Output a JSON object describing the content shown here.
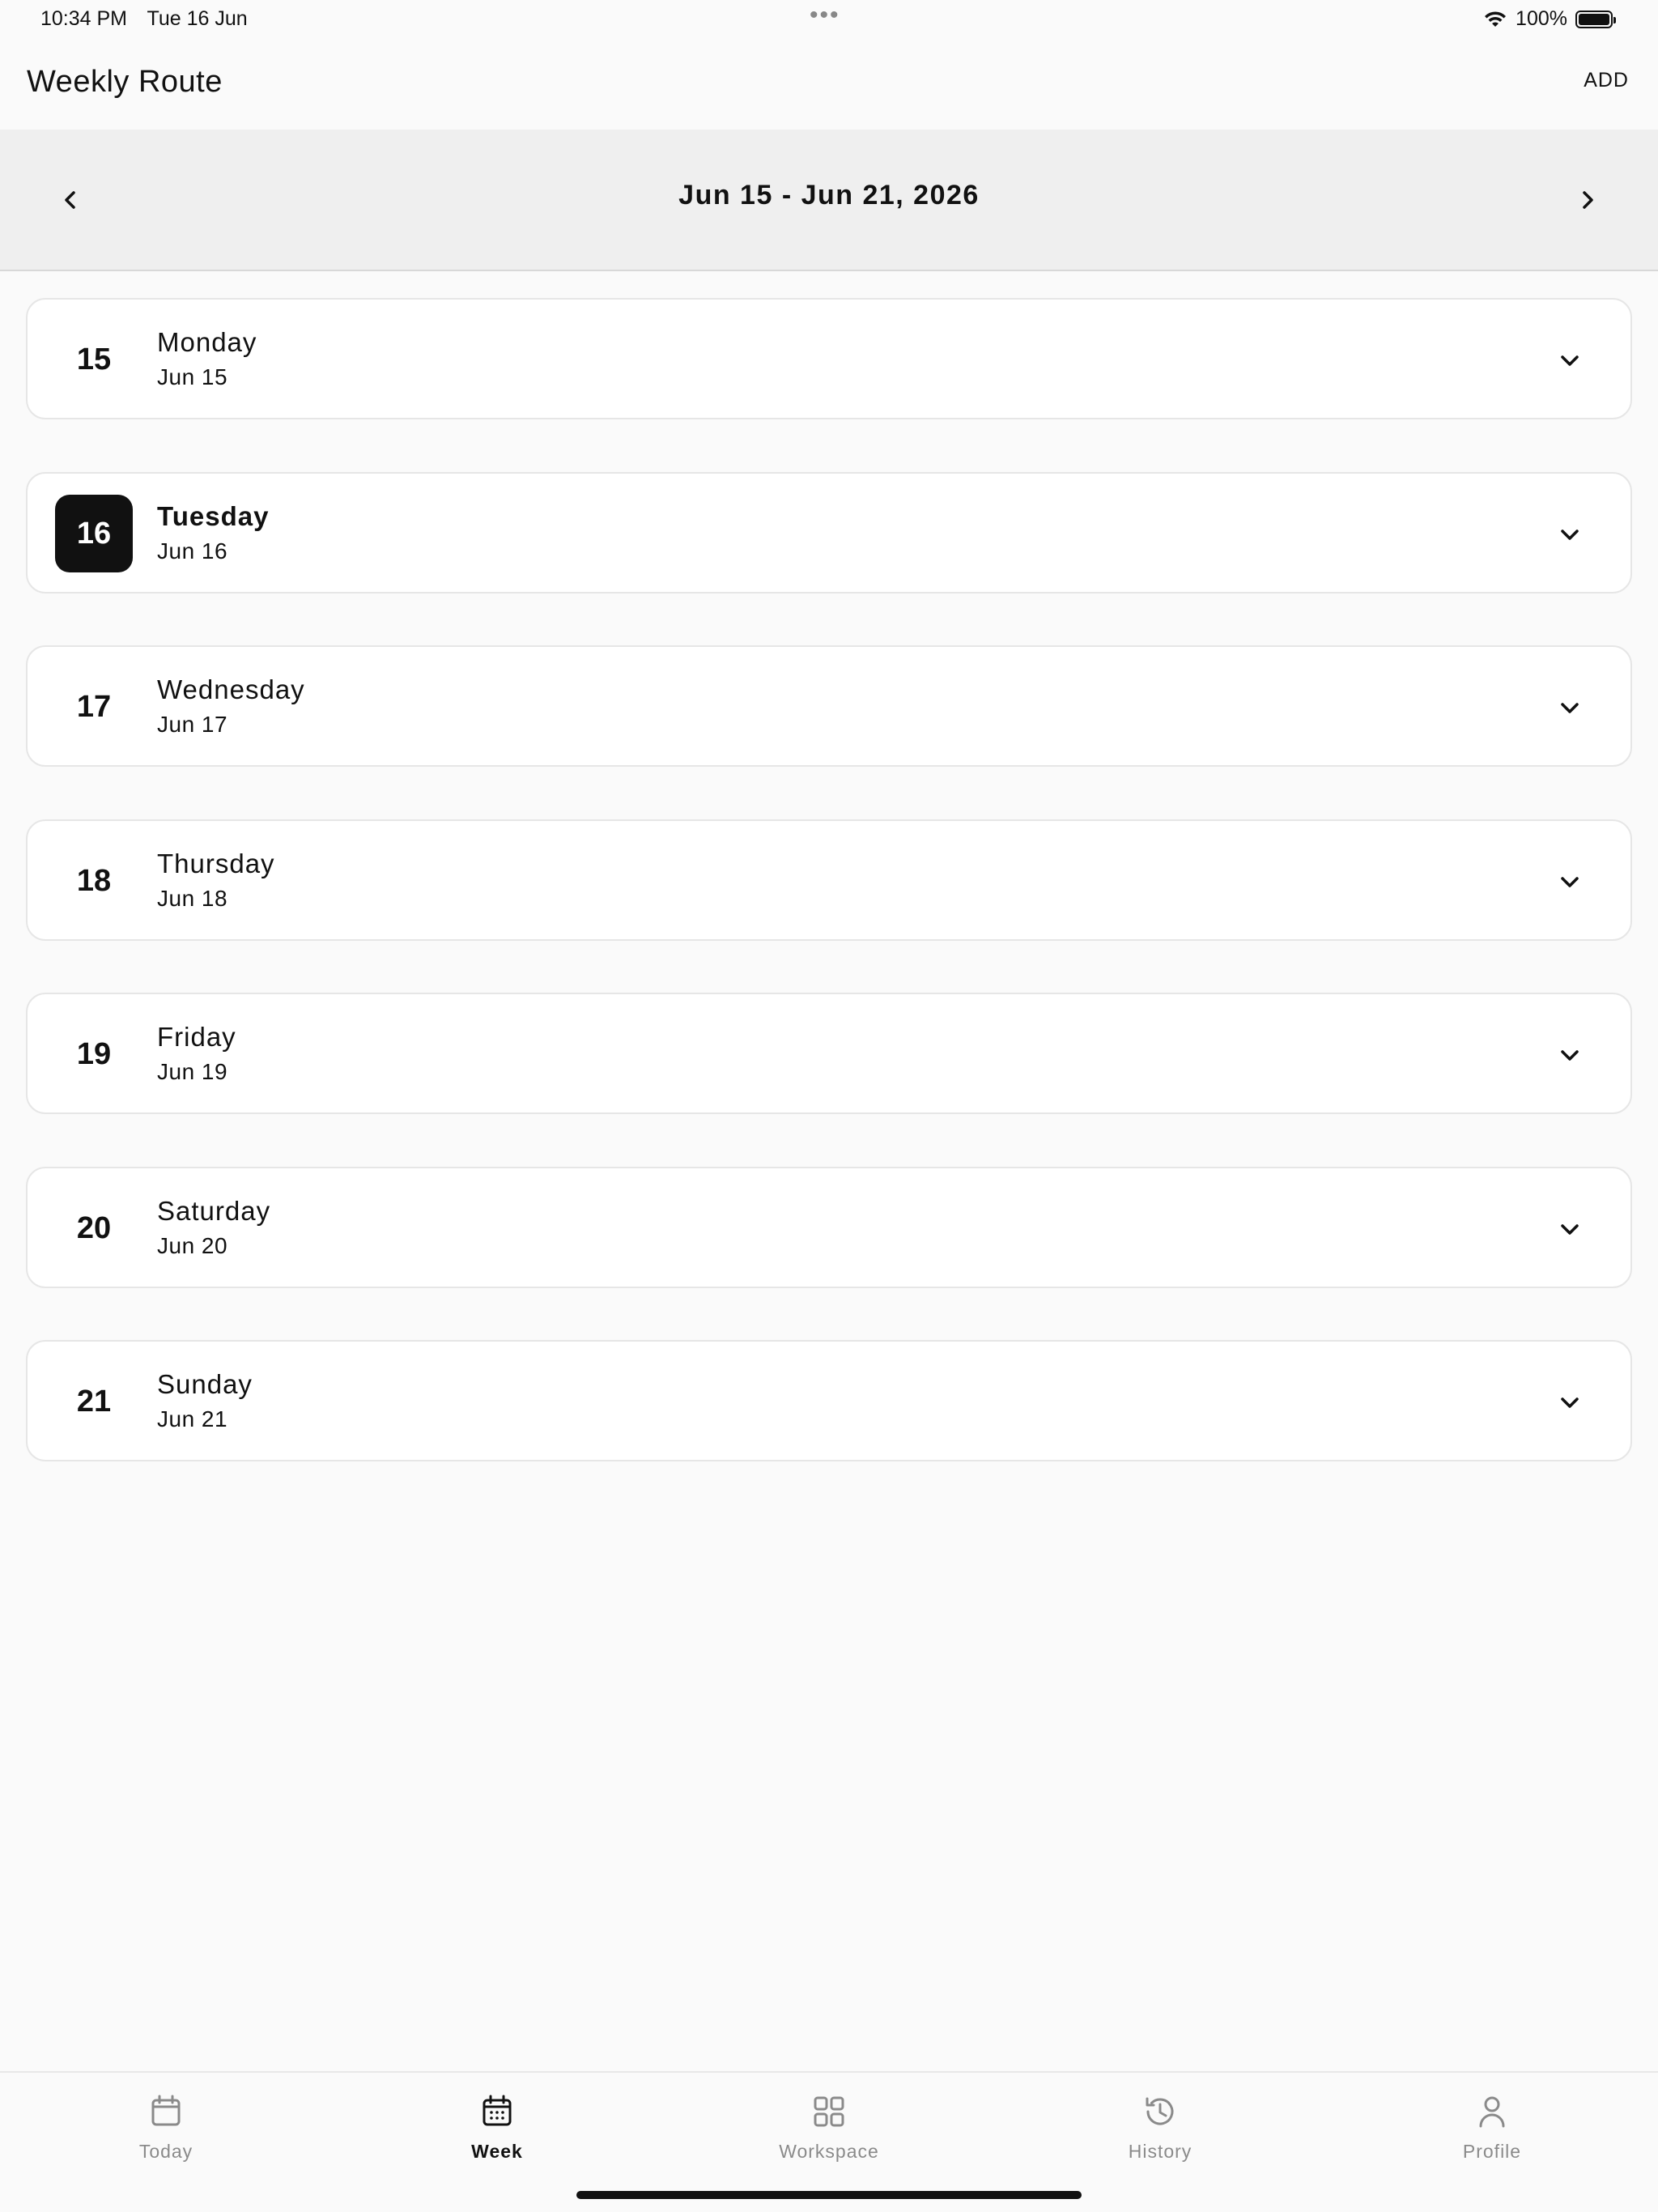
{
  "status_bar": {
    "time": "10:34 PM",
    "date": "Tue 16 Jun",
    "dots": "•••",
    "battery_percent": "100%"
  },
  "header": {
    "title": "Weekly Route",
    "add_label": "ADD"
  },
  "week_nav": {
    "range": "Jun 15 - Jun 21, 2026",
    "prev_icon": "chevron-left-icon",
    "next_icon": "chevron-right-icon"
  },
  "days": [
    {
      "num": "15",
      "name": "Monday",
      "date": "Jun 15",
      "selected": false
    },
    {
      "num": "16",
      "name": "Tuesday",
      "date": "Jun 16",
      "selected": true
    },
    {
      "num": "17",
      "name": "Wednesday",
      "date": "Jun 17",
      "selected": false
    },
    {
      "num": "18",
      "name": "Thursday",
      "date": "Jun 18",
      "selected": false
    },
    {
      "num": "19",
      "name": "Friday",
      "date": "Jun 19",
      "selected": false
    },
    {
      "num": "20",
      "name": "Saturday",
      "date": "Jun 20",
      "selected": false
    },
    {
      "num": "21",
      "name": "Sunday",
      "date": "Jun 21",
      "selected": false
    }
  ],
  "tabs": [
    {
      "label": "Today",
      "icon": "calendar-icon",
      "active": false
    },
    {
      "label": "Week",
      "icon": "calendar-week-icon",
      "active": true
    },
    {
      "label": "Workspace",
      "icon": "grid-icon",
      "active": false
    },
    {
      "label": "History",
      "icon": "history-icon",
      "active": false
    },
    {
      "label": "Profile",
      "icon": "person-icon",
      "active": false
    }
  ],
  "colors": {
    "background": "#fafafa",
    "selected_day": "#111111",
    "nav_bar": "#efefef",
    "inactive_tab": "#8a8a8a"
  }
}
